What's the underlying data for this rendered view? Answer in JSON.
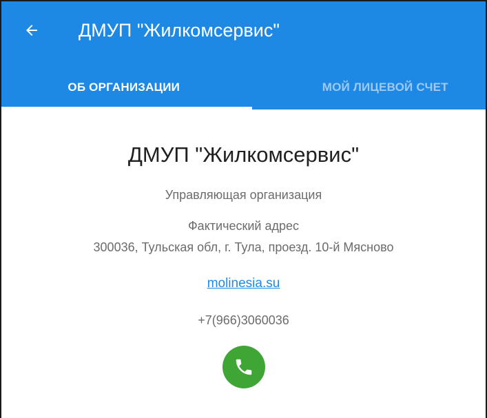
{
  "toolbar": {
    "back_icon": "arrow-left-icon",
    "title": "ДМУП \"Жилкомсервис\""
  },
  "tabs": [
    {
      "label": "ОБ ОРГАНИЗАЦИИ",
      "active": true
    },
    {
      "label": "МОЙ ЛИЦЕВОЙ СЧЕТ",
      "active": false
    }
  ],
  "org": {
    "name": "ДМУП \"Жилкомсервис\"",
    "type": "Управляющая организация",
    "address_label": "Фактический адрес",
    "address": "300036, Тульская обл, г. Тула, проезд. 10-й Мясново",
    "website": "molinesia.su",
    "phone": "+7(966)3060036",
    "call_icon": "phone-icon"
  },
  "colors": {
    "primary": "#1e88e5",
    "tab_inactive": "#9ec9f2",
    "call_button": "#3fa535",
    "secondary_text": "#6b6b6b"
  }
}
